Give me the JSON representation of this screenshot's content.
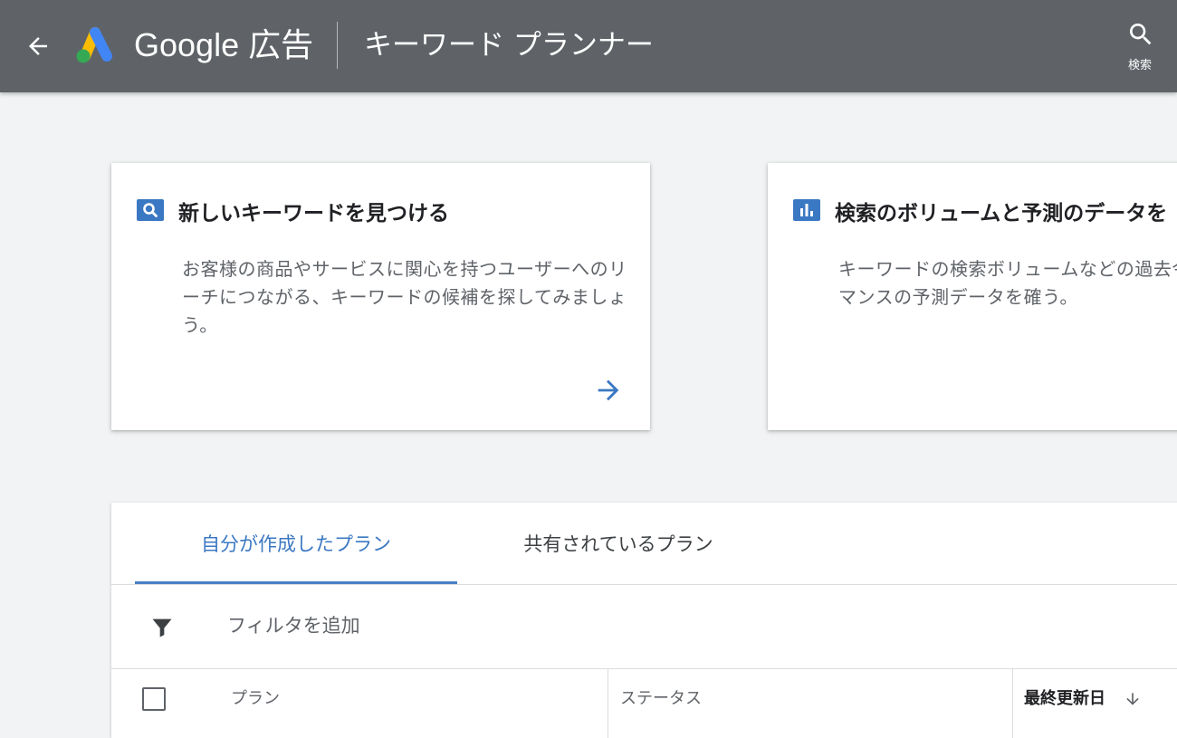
{
  "header": {
    "brand_name": "Google 広告",
    "page_title": "キーワード プランナー",
    "search_label": "検索",
    "colors": {
      "bar": "#5f6368",
      "logo_blue": "#4285f4",
      "logo_yellow": "#fbbc04",
      "logo_green": "#34a853"
    }
  },
  "cards": [
    {
      "icon": "search-icon",
      "title": "新しいキーワードを見つける",
      "description": "お客様の商品やサービスに関心を持つユーザーへのリーチにつながる、キーワードの候補を探してみましょう。"
    },
    {
      "icon": "bar-chart-icon",
      "title": "検索のボリュームと予測のデータを",
      "description": "キーワードの検索ボリュームなどの過去今後のパフォーマンスの予測データを確う。"
    }
  ],
  "plans": {
    "tabs": [
      {
        "label": "自分が作成したプラン",
        "active": true
      },
      {
        "label": "共有されているプラン",
        "active": false
      }
    ],
    "filter_label": "フィルタを追加",
    "columns": {
      "plan": "プラン",
      "status": "ステータス",
      "last_updated": "最終更新日"
    },
    "accent_color": "#3b78c3"
  }
}
